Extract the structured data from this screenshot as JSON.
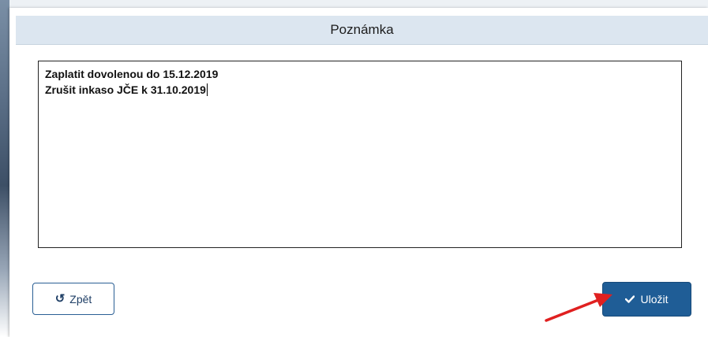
{
  "dialog": {
    "title": "Poznámka",
    "note_lines": [
      "Zaplatit dovolenou do 15.12.2019",
      "Zrušit inkaso JČE k 31.10.2019"
    ]
  },
  "buttons": {
    "back_label": "Zpět",
    "save_label": "Uložit"
  },
  "icons": {
    "back": "undo-icon",
    "save": "check-icon"
  },
  "colors": {
    "header_bg": "#dce6f0",
    "primary": "#1f5d96",
    "annotation_arrow": "#e02020"
  }
}
